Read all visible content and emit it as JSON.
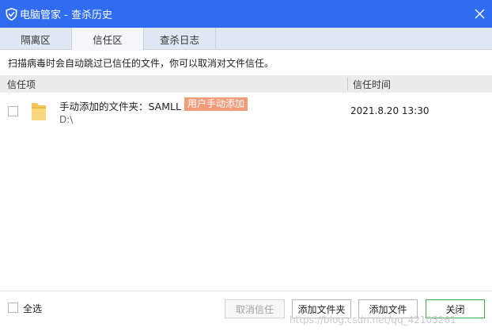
{
  "window": {
    "app_name": "电脑管家 - 查杀历史",
    "close_icon": "close-icon",
    "logo_icon": "shield-icon"
  },
  "tabs": [
    {
      "label": "隔离区",
      "active": false
    },
    {
      "label": "信任区",
      "active": true
    },
    {
      "label": "查杀日志",
      "active": false
    }
  ],
  "hint": "扫描病毒时会自动跳过已信任的文件，你可以取消对文件信任。",
  "table": {
    "headers": {
      "item": "信任项",
      "time": "信任时间"
    },
    "rows": [
      {
        "checked": false,
        "icon": "folder-icon",
        "name": "手动添加的文件夹：SAMLL",
        "badge": "用户手动添加",
        "path": "D:\\",
        "time": "2021.8.20 13:30"
      }
    ]
  },
  "footer": {
    "select_all_label": "全选",
    "select_all_checked": false,
    "buttons": {
      "cancel_trust": "取消信任",
      "add_folder": "添加文件夹",
      "add_file": "添加文件",
      "close": "关闭"
    }
  },
  "watermark": "https://blog.csdn.net/qq_42105261",
  "colors": {
    "titlebar": "#2f6cf0",
    "tabbar": "#dfe8f3",
    "badge": "#f29c7a",
    "primary_border": "#3fae4a"
  }
}
